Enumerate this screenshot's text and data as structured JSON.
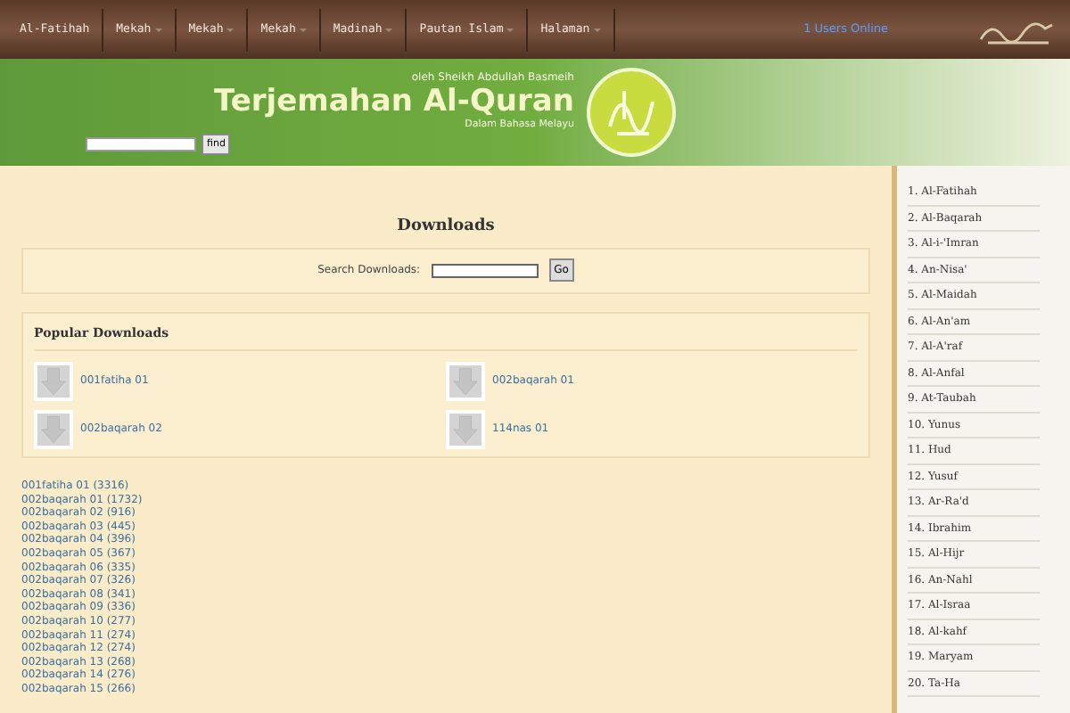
{
  "nav": {
    "items": [
      {
        "label": "Al-Fatihah",
        "dropdown": false
      },
      {
        "label": "Mekah",
        "dropdown": true
      },
      {
        "label": "Mekah",
        "dropdown": true
      },
      {
        "label": "Mekah",
        "dropdown": true
      },
      {
        "label": "Madinah",
        "dropdown": true
      },
      {
        "label": "Pautan Islam",
        "dropdown": true
      },
      {
        "label": "Halaman",
        "dropdown": true
      }
    ],
    "online": "1 Users Online"
  },
  "banner": {
    "byline": "oleh Sheikh Abdullah Basmeih",
    "title": "Terjemahan Al-Quran",
    "subtitle": "Dalam Bahasa Melayu",
    "search_button": "find"
  },
  "main": {
    "heading": "Downloads",
    "search": {
      "label": "Search Downloads:",
      "button": "Go"
    },
    "popular": {
      "heading": "Popular Downloads",
      "items": [
        "001fatiha 01",
        "002baqarah 01",
        "002baqarah 02",
        "114nas 01"
      ]
    },
    "list": [
      "001fatiha 01 (3316)",
      "002baqarah 01 (1732)",
      "002baqarah 02 (916)",
      "002baqarah 03 (445)",
      "002baqarah 04 (396)",
      "002baqarah 05 (367)",
      "002baqarah 06 (335)",
      "002baqarah 07 (326)",
      "002baqarah 08 (341)",
      "002baqarah 09 (336)",
      "002baqarah 10 (277)",
      "002baqarah 11 (274)",
      "002baqarah 12 (274)",
      "002baqarah 13 (268)",
      "002baqarah 14 (276)",
      "002baqarah 15 (266)"
    ]
  },
  "sidebar": {
    "items": [
      "1. Al-Fatihah",
      "2. Al-Baqarah",
      "3. Al-i-'Imran",
      "4. An-Nisa'",
      "5. Al-Maidah",
      "6. Al-An'am",
      "7. Al-A'raf",
      "8. Al-Anfal",
      "9. At-Taubah",
      "10. Yunus",
      "11. Hud",
      "12. Yusuf",
      "13. Ar-Ra'd",
      "14. Ibrahim",
      "15. Al-Hijr",
      "16. An-Nahl",
      "17. Al-Israa",
      "18. Al-kahf",
      "19. Maryam",
      "20. Ta-Ha"
    ]
  }
}
